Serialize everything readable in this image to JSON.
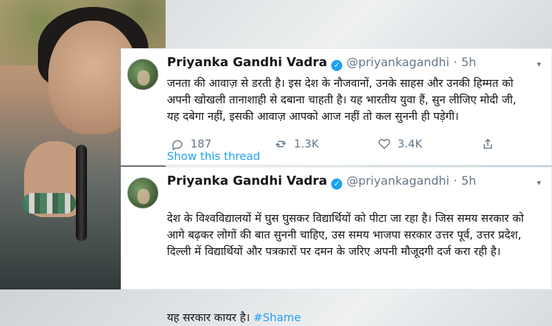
{
  "tweets": [
    {
      "name": "Priyanka Gandhi Vadra",
      "handle": "@priyankagandhi",
      "dot": "·",
      "time": "5h",
      "text": "जनता की आवाज़ से डरती है। इस देश के नौजवानों, उनके साहस और उनकी हिम्मत को\nअपनी खोखली तानाशाही से दबाना चाहती है। यह भारतीय युवा हैं, सुन लीजिए मोदी जी,\nयह दबेगा नहीं, इसकी आवाज़ आपको आज नहीं तो कल सुननी ही पड़ेगी।",
      "replies": "187",
      "retweets": "1.3K",
      "likes": "3.4K",
      "show_thread": "Show this thread"
    },
    {
      "name": "Priyanka Gandhi Vadra",
      "handle": "@priyankagandhi",
      "dot": "·",
      "time": "5h",
      "text_main": "देश के विश्वविद्यालयों में घुस घुसकर विद्यार्थियों को पीटा जा रहा है। जिस समय सरकार को\nआगे बढ़कर लोगों की बात सुननी चाहिए, उस समय भाजपा सरकार उत्तर पूर्व, उत्तर प्रदेश,\nदिल्ली में विद्यार्थियों और पत्रकारों पर दमन के जरिए अपनी मौजूदगी दर्ज करा रही है।",
      "text_end_prefix": "यह सरकार कायर है। ",
      "hashtag": "#Shame"
    }
  ],
  "icons": {
    "verified": "verified-check",
    "reply": "reply-icon",
    "retweet": "retweet-icon",
    "like": "like-heart-icon",
    "share": "share-icon",
    "caret": "caret-down-icon"
  },
  "colors": {
    "twitter_blue": "#1da1f2",
    "text_primary": "#14171a",
    "text_secondary": "#657786",
    "border": "#e6ecf0"
  }
}
